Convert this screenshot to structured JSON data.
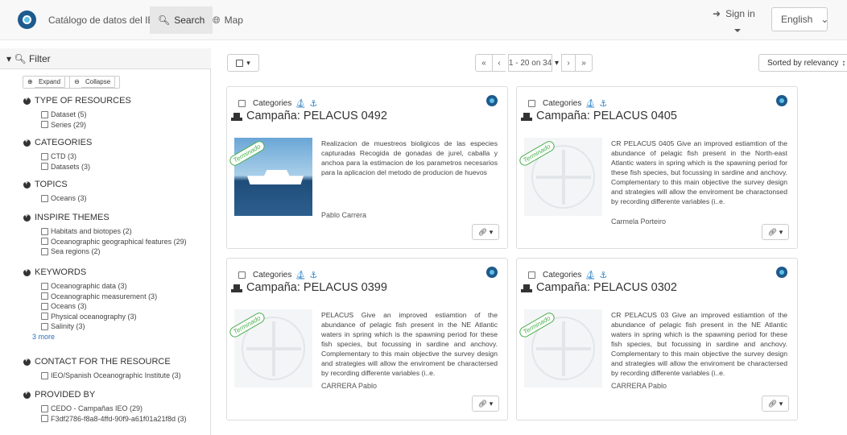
{
  "header": {
    "brand": "Catálogo de datos del IEO",
    "search_label": "Search",
    "map_label": "Map",
    "signin_label": "Sign in",
    "language": "English"
  },
  "sidebar": {
    "filter_label": "Filter",
    "expand_label": "Expand",
    "collapse_label": "Collapse",
    "sections": [
      {
        "title": "TYPE OF RESOURCES",
        "items": [
          "Dataset (5)",
          "Series (29)"
        ]
      },
      {
        "title": "CATEGORIES",
        "items": [
          "CTD (3)",
          "Datasets (3)"
        ]
      },
      {
        "title": "TOPICS",
        "items": [
          "Oceans (3)"
        ]
      },
      {
        "title": "INSPIRE THEMES",
        "items": [
          "Habitats and biotopes (2)",
          "Oceanographic geographical features (29)",
          "Sea regions (2)"
        ]
      },
      {
        "title": "KEYWORDS",
        "items": [
          "Oceanographic data (3)",
          "Oceanographic measurement (3)",
          "Oceans (3)",
          "Physical oceanography (3)",
          "Salinity (3)"
        ],
        "more": "3 more"
      },
      {
        "title": "CONTACT FOR THE RESOURCE",
        "items": [
          "IEO/Spanish Oceanographic Institute (3)"
        ]
      },
      {
        "title": "PROVIDED BY",
        "items": [
          "CEDO - Campañas IEO (29)",
          "F3df2786-f8a8-4ffd-90f9-a61f01a21f8d (3)"
        ]
      }
    ]
  },
  "results": {
    "pager_first": "«",
    "pager_prev": "‹",
    "pager_range": "1 - 20 on 34",
    "pager_next": "›",
    "pager_last": "»",
    "sort_label": "Sorted by relevancy"
  },
  "cards": [
    {
      "categories_label": "Categories",
      "title": "Campaña: PELACUS 0492",
      "badge": "Terminado",
      "description": "Realizacion de muestreos bioligicos de las especies capturadas Recogida de gonadas de jurel, caballa y anchoa para la estimacion de los parametros necesarios para la aplicacion del metodo de producion de huevos",
      "author": "Pablo Carrera"
    },
    {
      "categories_label": "Categories",
      "title": "Campaña: PELACUS 0405",
      "badge": "Terminado",
      "description": "CR PELACUS 0405 Give an improved estiamtion of the abundance of pelagic fish present in the North-east Atlantic waters in spring which is the spawning period for these fish species, but focussing in sardine and anchovy. Complementary to this main objective the survey design and strategies will allow the enviroment be charactonsed by recording differente variables (i..e.",
      "author": "Carmela Porteiro"
    },
    {
      "categories_label": "Categories",
      "title": "Campaña: PELACUS 0399",
      "badge": "Terminado",
      "description": "PELACUS Give an improved estiamtion of the abundance of pelagic fish present in the NE Atlantic waters in spring which is the spawning period for these fish species, but focussing in sardine and anchovy. Complementary to this main objective the survey design and strategies will allow the enviroment be charactersed by recording differente variables (i..e.",
      "author": "CARRERA Pablo"
    },
    {
      "categories_label": "Categories",
      "title": "Campaña: PELACUS 0302",
      "badge": "Terminado",
      "description": "CR PELACUS 03 Give an improved estiamtion of the abundance of pelagic fish present in the NE Atlantic waters in spring which is the spawning period for these fish species, but focussing in sardine and anchovy. Complementary to this main objective the survey design and strategies will allow the enviroment be charactersed by recording differente variables (i..e.",
      "author": "CARRERA Pablo"
    }
  ]
}
